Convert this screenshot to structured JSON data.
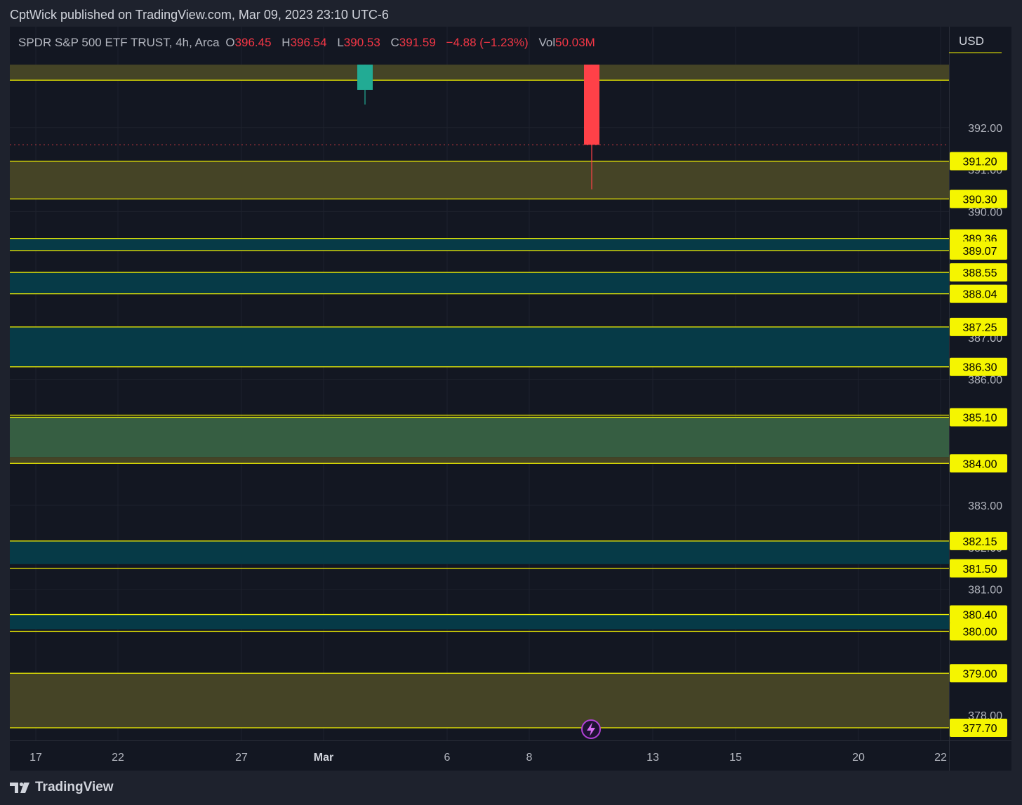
{
  "header": {
    "published": "CptWick published on TradingView.com, Mar 09, 2023 23:10 UTC-6"
  },
  "legend": {
    "symbol": "SPDR S&P 500 ETF TRUST, 4h, Arca",
    "o_key": "O",
    "o_val": "396.45",
    "h_key": "H",
    "h_val": "396.54",
    "l_key": "L",
    "l_val": "390.53",
    "c_key": "C",
    "c_val": "391.59",
    "change": "−4.88 (−1.23%)",
    "vol_key": "Vol",
    "vol_val": "50.03M"
  },
  "footer": {
    "brand": "TradingView"
  },
  "colors": {
    "level_line": "#f5f500",
    "label_bg": "#f5f500",
    "olive_zone": "#454426",
    "teal_zone": "#063a47",
    "green_zone": "#365e42",
    "up_candle": "#22ab94",
    "down_candle": "#ff4148",
    "grid": "#1e222d",
    "axis_text": "#b2b5be"
  },
  "chart_data": {
    "type": "candlestick",
    "currency": "USD",
    "ylim": [
      377.55,
      393.0
    ],
    "y_ticks": [
      {
        "value": 392,
        "label": "392.00"
      },
      {
        "value": 391,
        "label": "391.00"
      },
      {
        "value": 390,
        "label": "390.00"
      },
      {
        "value": 387,
        "label": "387.00"
      },
      {
        "value": 386,
        "label": "386.00"
      },
      {
        "value": 383,
        "label": "383.00"
      },
      {
        "value": 382,
        "label": "382.00"
      },
      {
        "value": 381,
        "label": "381.00"
      },
      {
        "value": 378,
        "label": "378.00"
      }
    ],
    "x_ticks": [
      "17",
      "22",
      "27",
      "Mar",
      "6",
      "8",
      "13",
      "15",
      "20",
      "22"
    ],
    "x_ticks_bold": [
      "Mar"
    ],
    "levels": [
      {
        "value": 393.13,
        "label": ""
      },
      {
        "value": 391.2,
        "label": "391.20"
      },
      {
        "value": 390.3,
        "label": "390.30"
      },
      {
        "value": 389.36,
        "label": "389.36"
      },
      {
        "value": 389.07,
        "label": "389.07"
      },
      {
        "value": 388.55,
        "label": "388.55"
      },
      {
        "value": 388.04,
        "label": "388.04"
      },
      {
        "value": 387.25,
        "label": "387.25"
      },
      {
        "value": 386.3,
        "label": "386.30"
      },
      {
        "value": 385.15,
        "label": ""
      },
      {
        "value": 385.1,
        "label": "385.10"
      },
      {
        "value": 384.0,
        "label": "384.00"
      },
      {
        "value": 382.15,
        "label": "382.15"
      },
      {
        "value": 381.5,
        "label": "381.50"
      },
      {
        "value": 380.4,
        "label": "380.40"
      },
      {
        "value": 380.0,
        "label": "380.00"
      },
      {
        "value": 379.0,
        "label": "379.00"
      },
      {
        "value": 377.7,
        "label": "377.70"
      }
    ],
    "zones": [
      {
        "top": 393.5,
        "bottom": 393.13,
        "color": "olive"
      },
      {
        "top": 391.2,
        "bottom": 390.3,
        "color": "olive"
      },
      {
        "top": 389.36,
        "bottom": 389.07,
        "color": "teal"
      },
      {
        "top": 388.55,
        "bottom": 388.04,
        "color": "teal"
      },
      {
        "top": 387.25,
        "bottom": 386.3,
        "color": "teal"
      },
      {
        "top": 385.1,
        "bottom": 384.15,
        "color": "green"
      },
      {
        "top": 384.15,
        "bottom": 384.0,
        "color": "olive"
      },
      {
        "top": 382.15,
        "bottom": 381.6,
        "color": "teal"
      },
      {
        "top": 380.4,
        "bottom": 380.05,
        "color": "teal"
      },
      {
        "top": 379.0,
        "bottom": 377.7,
        "color": "olive"
      }
    ],
    "candles": [
      {
        "date": "Mar 2",
        "open": 393.5,
        "high": 393.5,
        "close": 392.9,
        "low": 392.55,
        "direction": "up"
      },
      {
        "date": "Mar 9",
        "open": 393.5,
        "high": 393.5,
        "close": 391.59,
        "low": 390.53,
        "direction": "down"
      }
    ],
    "current_price": 391.59
  }
}
